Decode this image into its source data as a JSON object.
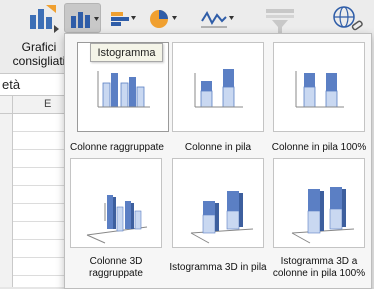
{
  "ribbon": {
    "recommended_charts_label": "Grafici consigliati"
  },
  "sheet": {
    "formula_value": "età",
    "column_header": "E"
  },
  "gallery": {
    "tooltip": "Istogramma",
    "tiles": [
      {
        "label": "Colonne raggruppate"
      },
      {
        "label": "Colonne in pila"
      },
      {
        "label": "Colonne in pila 100%"
      },
      {
        "label": "Colonne 3D raggruppate"
      },
      {
        "label": "Istogramma 3D in pila"
      },
      {
        "label": "Istogramma 3D a colonne in pila 100%"
      }
    ]
  },
  "colors": {
    "accent_blue": "#5b7fc4",
    "light_blue": "#c9d8f1",
    "ribbon_bg": "#ececec"
  }
}
